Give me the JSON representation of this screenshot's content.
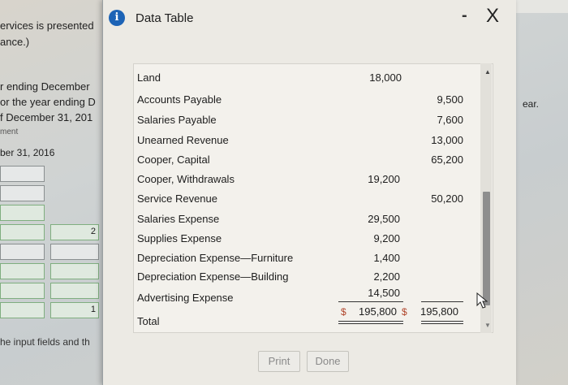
{
  "background": {
    "left_texts": [
      "ervices is presented",
      "ance.)",
      "r ending December",
      "or the year ending D",
      "f December 31, 201",
      "ment",
      "ber 31, 2016"
    ],
    "hint_text": "he input fields and th",
    "row_box_labels": [
      "2",
      "1"
    ],
    "right_text": "ear."
  },
  "dialog": {
    "title": "Data Table",
    "info_icon": "i",
    "minimize_label": "-",
    "close_label": "X",
    "buttons": {
      "print": "Print",
      "done": "Done"
    }
  },
  "table": {
    "rows": [
      {
        "account": "Land",
        "debit": "18,000",
        "credit": ""
      },
      {
        "account": "Accounts Payable",
        "debit": "",
        "credit": "9,500"
      },
      {
        "account": "Salaries Payable",
        "debit": "",
        "credit": "7,600"
      },
      {
        "account": "Unearned Revenue",
        "debit": "",
        "credit": "13,000"
      },
      {
        "account": "Cooper, Capital",
        "debit": "",
        "credit": "65,200"
      },
      {
        "account": "Cooper, Withdrawals",
        "debit": "19,200",
        "credit": ""
      },
      {
        "account": "Service Revenue",
        "debit": "",
        "credit": "50,200"
      },
      {
        "account": "Salaries Expense",
        "debit": "29,500",
        "credit": ""
      },
      {
        "account": "Supplies Expense",
        "debit": "9,200",
        "credit": ""
      },
      {
        "account": "Depreciation Expense—Furniture",
        "debit": "1,400",
        "credit": ""
      },
      {
        "account": "Depreciation Expense—Building",
        "debit": "2,200",
        "credit": ""
      },
      {
        "account": "Advertising Expense",
        "debit": "14,500",
        "credit": ""
      }
    ],
    "total": {
      "account": "Total",
      "currency": "$",
      "debit": "195,800",
      "credit": "195,800"
    }
  },
  "colors": {
    "info_icon": "#1c63b6",
    "currency": "#b0442a"
  }
}
